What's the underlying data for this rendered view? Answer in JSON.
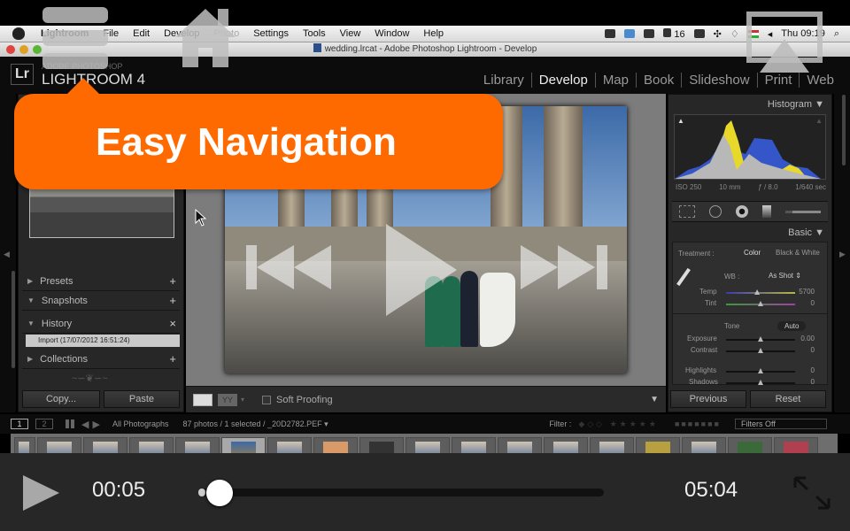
{
  "menubar": {
    "items": [
      "Lightroom",
      "File",
      "Edit",
      "Develop",
      "Photo",
      "Settings",
      "Tools",
      "View",
      "Window",
      "Help"
    ],
    "status": {
      "adobe_badge": "16",
      "clock": "Thu 09:19"
    }
  },
  "window": {
    "title": "wedding.lrcat - Adobe Photoshop Lightroom - Develop"
  },
  "app": {
    "logo": "Lr",
    "brand_sub": "ADOBE PHOTOSHOP",
    "brand_name": "LIGHTROOM 4",
    "modules": [
      {
        "label": "Library",
        "active": false
      },
      {
        "label": "Develop",
        "active": true
      },
      {
        "label": "Map",
        "active": false
      },
      {
        "label": "Book",
        "active": false
      },
      {
        "label": "Slideshow",
        "active": false
      },
      {
        "label": "Print",
        "active": false
      },
      {
        "label": "Web",
        "active": false
      }
    ]
  },
  "callout": {
    "text": "Easy Navigation",
    "color": "#ff6a00"
  },
  "left_panel": {
    "sections": [
      {
        "label": "Presets",
        "expanded": false,
        "action": "+"
      },
      {
        "label": "Snapshots",
        "expanded": true,
        "action": "+"
      },
      {
        "label": "History",
        "expanded": true,
        "action": "×"
      },
      {
        "label": "Collections",
        "expanded": false,
        "action": "+"
      }
    ],
    "history_items": [
      "Import (17/07/2012 16:51:24)"
    ],
    "buttons": {
      "copy": "Copy...",
      "paste": "Paste"
    }
  },
  "center_toolbar": {
    "soft_proofing_label": "Soft Proofing",
    "soft_proofing_checked": false,
    "compare_label": "YY"
  },
  "right_panel": {
    "histogram": {
      "title": "Histogram",
      "iso": "ISO 250",
      "focal": "10 mm",
      "aperture": "ƒ / 8.0",
      "shutter": "1/640 sec"
    },
    "basic": {
      "title": "Basic",
      "treatment_label": "Treatment :",
      "treatment_options": [
        "Color",
        "Black & White"
      ],
      "treatment_selected": "Color",
      "wb_label": "WB :",
      "wb_value": "As Shot",
      "tone_label": "Tone",
      "auto_label": "Auto",
      "sliders": [
        {
          "label": "Temp",
          "value": "5700",
          "position": 0.45
        },
        {
          "label": "Tint",
          "value": "0",
          "position": 0.5
        },
        {
          "label": "Exposure",
          "value": "0.00",
          "position": 0.5
        },
        {
          "label": "Contrast",
          "value": "0",
          "position": 0.5
        },
        {
          "label": "Highlights",
          "value": "0",
          "position": 0.5
        },
        {
          "label": "Shadows",
          "value": "0",
          "position": 0.5
        }
      ]
    },
    "buttons": {
      "previous": "Previous",
      "reset": "Reset"
    }
  },
  "filmstrip_bar": {
    "view1": "1",
    "view2": "2",
    "source": "All Photographs",
    "count": "87 photos / 1 selected / _20D2782.PEF",
    "filter_label": "Filter :",
    "filter_value": "Filters Off"
  },
  "player": {
    "current_time": "00:05",
    "total_time": "05:04",
    "progress": 0.0166
  }
}
